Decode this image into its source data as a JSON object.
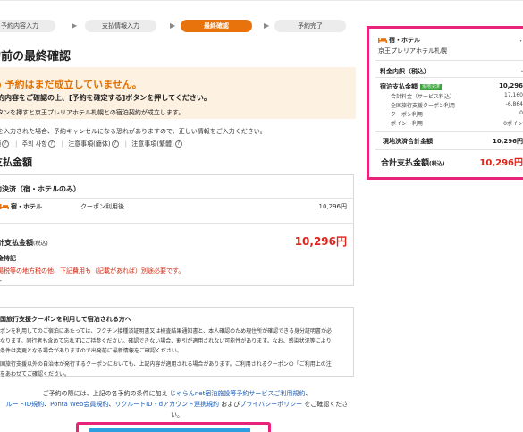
{
  "steps": [
    {
      "label": "予約内容入力"
    },
    {
      "label": "支払情報入力"
    },
    {
      "label": "最終確認"
    },
    {
      "label": "予約完了"
    }
  ],
  "page_title": "約前の最終確認",
  "warning": {
    "title": "予約はまだ成立していません。",
    "line1": "約内容をご確認の上、[予約を確定する]ボタンを押してください。",
    "line2": "タンを押すと京王プレリアホテル札幌との宿泊契約が成立します。"
  },
  "info_line": "を入力された場合、予約キャンセルになる恐れがありますので、正しい情報をご入力ください。",
  "policy_links": {
    "a": "項",
    "b": "주의 사항",
    "c": "注意事項(簡体)",
    "d": "注意事項(繁體)"
  },
  "payment": {
    "heading": "支払金額",
    "local_title": "地決済（宿・ホテルのみ）",
    "hotel_label": "宿・ホテル",
    "coupon_label": "クーポン利用後",
    "hotel_amount": "10,296円",
    "total_label": "計支払金額",
    "total_label_small": "(税込)",
    "total_amount": "10,296円",
    "special_label": "金特記",
    "special_note": "湯税等の地方税の他、下記費用も（記載があれば）別途必要です。",
    "dash": "--"
  },
  "coupon_notice": {
    "title": "国旅行支援クーポンを利用して宿泊される方へ",
    "lines": [
      "ポンを利用してのご宿泊にあたっては、ワクチン接種済証明書又は検査結果通知書と、本人確認のため現住所が確認できる身分証明書が必",
      "なります。同行者も含めて忘れずにご持参ください。確認できない場合、割引が適用されない可能性があります。なお、感染状況等により",
      "条件は変更となる場合がありますので出発前に最新情報をご確認ください。",
      "国旅行支援以外の自治体が発行するクーポンにおいても、上記内容が適用される場合があります。ご利用されるクーポンの「ご利用上の注",
      "をあわせてご確認ください。"
    ]
  },
  "terms": {
    "line1_pre": "ご予約の際には、上記の各予約の条件に加え ",
    "line1_link": "じゃらんnet宿泊施設等予約サービスご利用規約",
    "line1_post": "、",
    "line2_link1": "ルートID規約",
    "line2_sep1": "、",
    "line2_link2": "Ponta Web会員規約",
    "line2_sep2": "、",
    "line2_link3": "リクルートID・dアカウント連携規約",
    "line2_and": " および",
    "line2_link4": "プライバシーポリシー",
    "line2_post": " をご確認くださ",
    "line3": "い。"
  },
  "sidebar": {
    "title": "宿・ホテル",
    "hotel_name": "京王プレリアホテル札幌",
    "dot": "・",
    "breakdown_label": "料金内訳（税込）",
    "bullet": "・",
    "stay_label": "宿泊支払金額",
    "stay_badge": "現地決済",
    "stay_amount": "10,296",
    "items": [
      {
        "label": "合計料金（サービス料込）",
        "amount": "17,160"
      },
      {
        "label": "全国旅行支援クーポン利用",
        "amount": "-6,864"
      },
      {
        "label": "クーポン利用",
        "amount": "0"
      },
      {
        "label": "ポイント利用",
        "amount": "0ポイン"
      }
    ],
    "local_total_label": "現地決済合計金額",
    "local_total_amount": "10,296円",
    "grand_total_label": "合計支払金額",
    "grand_total_small": "(税込)",
    "grand_total_amount": "10,296円"
  },
  "colors": {
    "accent": "#e8720c",
    "price_red": "#e0231a",
    "highlight_frame": "#e8237a",
    "link": "#1a5bb5",
    "button": "#2b9fe0"
  }
}
